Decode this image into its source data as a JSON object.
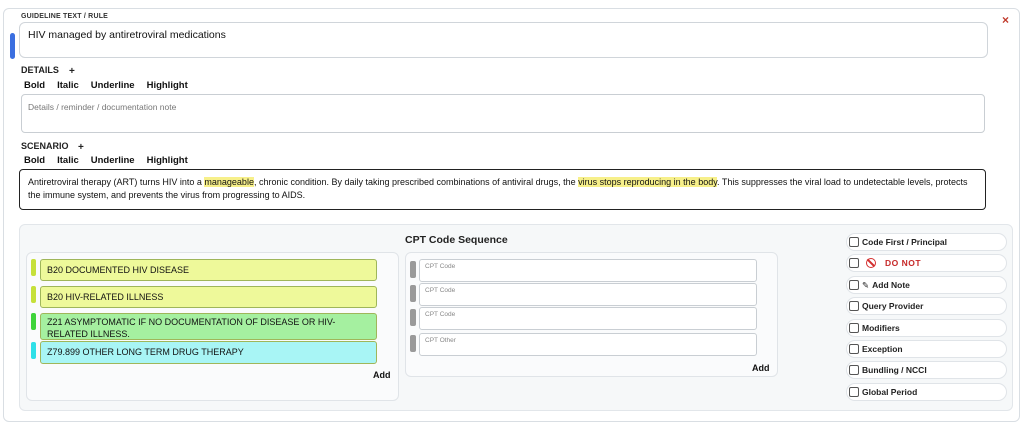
{
  "guideline": {
    "label": "GUIDELINE TEXT / RULE",
    "value": "HIV managed by antiretroviral medications",
    "close_icon": "close-icon"
  },
  "details": {
    "label": "DETAILS",
    "plus": "+",
    "toolbar": [
      "Bold",
      "Italic",
      "Underline",
      "Highlight"
    ],
    "placeholder": "Details / reminder / documentation note"
  },
  "scenario": {
    "label": "SCENARIO",
    "plus": "+",
    "toolbar": [
      "Bold",
      "Italic",
      "Underline",
      "Highlight"
    ],
    "text_parts": [
      "Antiretroviral therapy (ART) turns HIV into a ",
      "manageable",
      ", chronic condition. By daily taking prescribed combinations of antiviral drugs, the ",
      "virus stops reproducing in the body",
      ". This suppresses the viral load to undetectable levels, protects the immune system, and prevents the virus from progressing to AIDS."
    ],
    "highlight_color": "#f7f08a"
  },
  "dx_codes": {
    "items": [
      {
        "text": "B20 DOCUMENTED HIV DISEASE",
        "color": "#eef99a",
        "tab": "#c6e03a"
      },
      {
        "text": "B20 HIV-RELATED ILLNESS",
        "color": "#eef99a",
        "tab": "#c6e03a"
      },
      {
        "text": "Z21 ASYMPTOMATIC IF NO DOCUMENTATION OF DISEASE OR HIV-RELATED ILLNESS.",
        "color": "#a5f0a0",
        "tab": "#3fd43a"
      },
      {
        "text": "Z79.899 OTHER LONG TERM DRUG THERAPY",
        "color": "#a8f5f5",
        "tab": "#2ee0e8"
      }
    ],
    "add_label": "Add"
  },
  "cpt": {
    "title": "CPT Code Sequence",
    "placeholders": [
      "CPT Code",
      "CPT Code",
      "CPT Code",
      "CPT Other"
    ],
    "add_label": "Add"
  },
  "options": [
    {
      "label": "Code First / Principal",
      "icon": ""
    },
    {
      "label": "DO NOT",
      "icon": "no-entry-icon"
    },
    {
      "label": "Add Note",
      "icon": "pencil-icon",
      "glyph": "✎"
    },
    {
      "label": "Query Provider",
      "icon": ""
    },
    {
      "label": "Modifiers",
      "icon": ""
    },
    {
      "label": "Exception",
      "icon": ""
    },
    {
      "label": "Bundling / NCCI",
      "icon": ""
    },
    {
      "label": "Global Period",
      "icon": ""
    }
  ]
}
